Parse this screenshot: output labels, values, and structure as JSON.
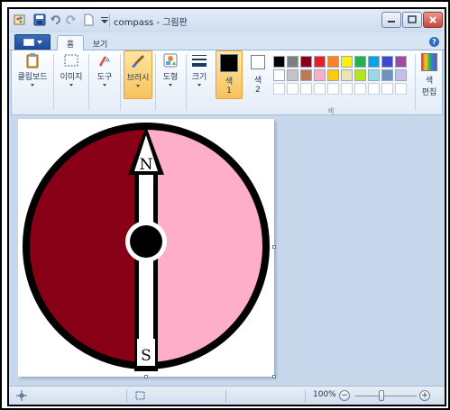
{
  "window": {
    "title": "compass - 그림판"
  },
  "tabs": {
    "home": "홈",
    "view": "보기"
  },
  "ribbon": {
    "clipboard": "클립보드",
    "image": "이미지",
    "tools": "도구",
    "brushes": "브러시",
    "shapes": "도형",
    "size": "크기",
    "color1": "색\n1",
    "color1_line1": "색",
    "color1_line2": "1",
    "color2_line1": "색",
    "color2_line2": "2",
    "edit_colors_line1": "색",
    "edit_colors_line2": "편집",
    "colors_group": "색"
  },
  "palette": {
    "row1": [
      "#000000",
      "#7f7f7f",
      "#880015",
      "#ed1c24",
      "#ff7f27",
      "#fff200",
      "#22b14c",
      "#00a2e8",
      "#3f48cc",
      "#a349a4"
    ],
    "row2": [
      "#ffffff",
      "#c3c3c3",
      "#b97a57",
      "#ffaec9",
      "#ffc90e",
      "#efe4b0",
      "#b5e61d",
      "#99d9ea",
      "#7092be",
      "#c8bfe7"
    ],
    "row3": [
      "#ffffff",
      "#ffffff",
      "#ffffff",
      "#ffffff",
      "#ffffff",
      "#ffffff",
      "#ffffff",
      "#ffffff",
      "#ffffff",
      "#ffffff"
    ],
    "color1": "#000000",
    "color2": "#ffffff"
  },
  "drawing": {
    "left_half_color": "#880015",
    "right_half_color": "#ffaec9",
    "north_label": "N",
    "south_label": "S"
  },
  "status": {
    "zoom": "100%",
    "zoom_minus": "−",
    "zoom_plus": "+"
  },
  "icons": {
    "app": "paint-app-icon",
    "save": "save-icon",
    "undo": "undo-icon",
    "redo": "redo-icon",
    "help": "help-icon"
  }
}
